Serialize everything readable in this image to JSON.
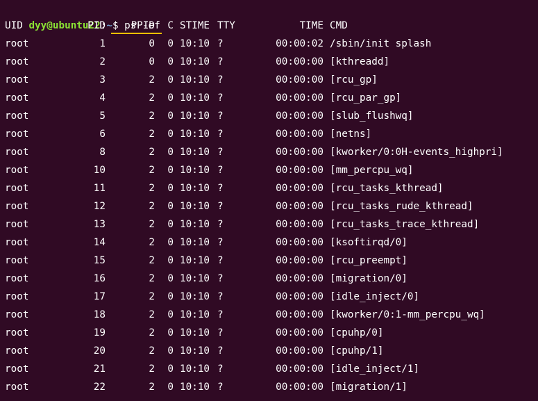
{
  "prompt": {
    "user_host": "dyy@ubuntu22",
    "separator": ":",
    "path": "~",
    "symbol": "$",
    "command": "ps -ef"
  },
  "table": {
    "headers": {
      "uid": "UID",
      "pid": "PID",
      "ppid": "PPID",
      "c": "C",
      "stime": "STIME",
      "tty": "TTY",
      "time": "TIME",
      "cmd": "CMD"
    },
    "rows": [
      {
        "uid": "root",
        "pid": "1",
        "ppid": "0",
        "c": "0",
        "stime": "10:10",
        "tty": "?",
        "time": "00:00:02",
        "cmd": "/sbin/init splash"
      },
      {
        "uid": "root",
        "pid": "2",
        "ppid": "0",
        "c": "0",
        "stime": "10:10",
        "tty": "?",
        "time": "00:00:00",
        "cmd": "[kthreadd]"
      },
      {
        "uid": "root",
        "pid": "3",
        "ppid": "2",
        "c": "0",
        "stime": "10:10",
        "tty": "?",
        "time": "00:00:00",
        "cmd": "[rcu_gp]"
      },
      {
        "uid": "root",
        "pid": "4",
        "ppid": "2",
        "c": "0",
        "stime": "10:10",
        "tty": "?",
        "time": "00:00:00",
        "cmd": "[rcu_par_gp]"
      },
      {
        "uid": "root",
        "pid": "5",
        "ppid": "2",
        "c": "0",
        "stime": "10:10",
        "tty": "?",
        "time": "00:00:00",
        "cmd": "[slub_flushwq]"
      },
      {
        "uid": "root",
        "pid": "6",
        "ppid": "2",
        "c": "0",
        "stime": "10:10",
        "tty": "?",
        "time": "00:00:00",
        "cmd": "[netns]"
      },
      {
        "uid": "root",
        "pid": "8",
        "ppid": "2",
        "c": "0",
        "stime": "10:10",
        "tty": "?",
        "time": "00:00:00",
        "cmd": "[kworker/0:0H-events_highpri]"
      },
      {
        "uid": "root",
        "pid": "10",
        "ppid": "2",
        "c": "0",
        "stime": "10:10",
        "tty": "?",
        "time": "00:00:00",
        "cmd": "[mm_percpu_wq]"
      },
      {
        "uid": "root",
        "pid": "11",
        "ppid": "2",
        "c": "0",
        "stime": "10:10",
        "tty": "?",
        "time": "00:00:00",
        "cmd": "[rcu_tasks_kthread]"
      },
      {
        "uid": "root",
        "pid": "12",
        "ppid": "2",
        "c": "0",
        "stime": "10:10",
        "tty": "?",
        "time": "00:00:00",
        "cmd": "[rcu_tasks_rude_kthread]"
      },
      {
        "uid": "root",
        "pid": "13",
        "ppid": "2",
        "c": "0",
        "stime": "10:10",
        "tty": "?",
        "time": "00:00:00",
        "cmd": "[rcu_tasks_trace_kthread]"
      },
      {
        "uid": "root",
        "pid": "14",
        "ppid": "2",
        "c": "0",
        "stime": "10:10",
        "tty": "?",
        "time": "00:00:00",
        "cmd": "[ksoftirqd/0]"
      },
      {
        "uid": "root",
        "pid": "15",
        "ppid": "2",
        "c": "0",
        "stime": "10:10",
        "tty": "?",
        "time": "00:00:00",
        "cmd": "[rcu_preempt]"
      },
      {
        "uid": "root",
        "pid": "16",
        "ppid": "2",
        "c": "0",
        "stime": "10:10",
        "tty": "?",
        "time": "00:00:00",
        "cmd": "[migration/0]"
      },
      {
        "uid": "root",
        "pid": "17",
        "ppid": "2",
        "c": "0",
        "stime": "10:10",
        "tty": "?",
        "time": "00:00:00",
        "cmd": "[idle_inject/0]"
      },
      {
        "uid": "root",
        "pid": "18",
        "ppid": "2",
        "c": "0",
        "stime": "10:10",
        "tty": "?",
        "time": "00:00:00",
        "cmd": "[kworker/0:1-mm_percpu_wq]"
      },
      {
        "uid": "root",
        "pid": "19",
        "ppid": "2",
        "c": "0",
        "stime": "10:10",
        "tty": "?",
        "time": "00:00:00",
        "cmd": "[cpuhp/0]"
      },
      {
        "uid": "root",
        "pid": "20",
        "ppid": "2",
        "c": "0",
        "stime": "10:10",
        "tty": "?",
        "time": "00:00:00",
        "cmd": "[cpuhp/1]"
      },
      {
        "uid": "root",
        "pid": "21",
        "ppid": "2",
        "c": "0",
        "stime": "10:10",
        "tty": "?",
        "time": "00:00:00",
        "cmd": "[idle_inject/1]"
      },
      {
        "uid": "root",
        "pid": "22",
        "ppid": "2",
        "c": "0",
        "stime": "10:10",
        "tty": "?",
        "time": "00:00:00",
        "cmd": "[migration/1]"
      }
    ]
  },
  "colors": {
    "background": "#300a24",
    "user_host": "#8ae234",
    "path": "#729fcf",
    "text": "#ffffff",
    "highlight_underline": "#f0c000"
  }
}
